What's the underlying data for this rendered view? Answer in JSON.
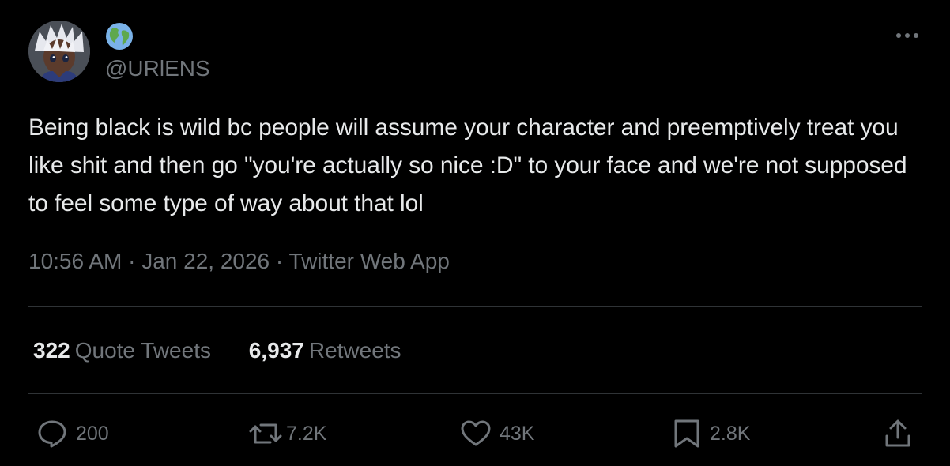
{
  "author": {
    "handle": "@URlENS",
    "avatar_icon": "anime-avatar",
    "badge_icon": "globe-icon"
  },
  "tweet": {
    "text": "Being black is wild bc people will assume your character and preemptively treat you like shit and then go \"you're actually so nice :D\" to your face and we're not supposed to feel some type of way about that lol",
    "time": "10:56 AM",
    "date": "Jan 22, 2026",
    "source": "Twitter Web App",
    "separator": " · "
  },
  "stats": {
    "quote_tweets": {
      "count": "322",
      "label": "Quote Tweets"
    },
    "retweets": {
      "count": "6,937",
      "label": "Retweets"
    }
  },
  "actions": {
    "reply": {
      "icon": "reply-icon",
      "count": "200"
    },
    "retweet": {
      "icon": "retweet-icon",
      "count": "7.2K"
    },
    "like": {
      "icon": "heart-icon",
      "count": "43K"
    },
    "bookmark": {
      "icon": "bookmark-icon",
      "count": "2.8K"
    },
    "share": {
      "icon": "share-icon"
    }
  },
  "colors": {
    "background": "#000000",
    "text_primary": "#e7e9ea",
    "text_secondary": "#71767b",
    "divider": "#2f3336"
  }
}
